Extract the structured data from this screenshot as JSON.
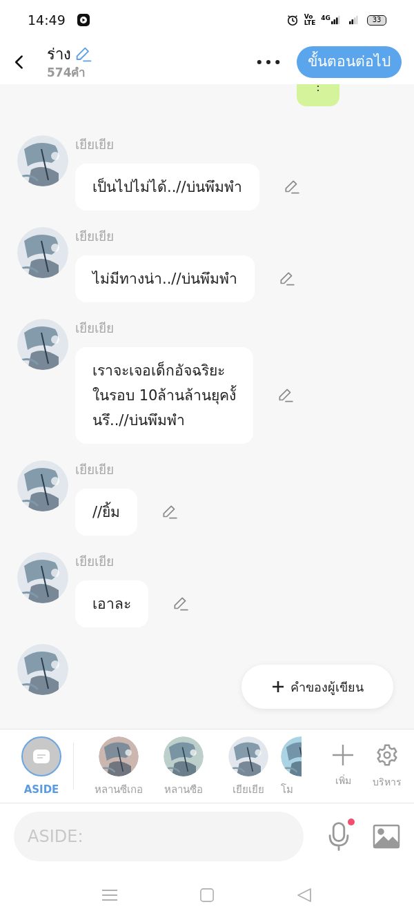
{
  "status_bar": {
    "time": "14:49",
    "volte_top": "Vo",
    "volte_bottom": "LTE",
    "network": "4G",
    "battery": "33"
  },
  "header": {
    "title": "ร่าง",
    "word_count": "574คำ",
    "next_button": "ขั้นตอนต่อไป"
  },
  "top_bubble": {
    "text": ":"
  },
  "messages": [
    {
      "name": "เยียเยีย",
      "lines": [
        "เป็นไปไม่ได้..//บ่นพึมพำ"
      ]
    },
    {
      "name": "เยียเยีย",
      "lines": [
        "ไม่มีทางน่า..//บ่นพึมพำ"
      ]
    },
    {
      "name": "เยียเยีย",
      "lines": [
        "เราจะเจอเด็กอัจฉริยะ",
        "ในรอบ 10ล้านล้านยุคงั้",
        "นรึ..//บ่นพึมพำ"
      ]
    },
    {
      "name": "เยียเยีย",
      "lines": [
        "//ยิ้ม"
      ]
    },
    {
      "name": "เยียเยีย",
      "lines": [
        "เอาละ"
      ]
    }
  ],
  "author_note_button": "คำของผู้เขียน",
  "characters": [
    {
      "kind": "aside",
      "name": "ASIDE",
      "selected": true
    },
    {
      "kind": "avatar",
      "name": "หลานซีเกอ",
      "selected": false
    },
    {
      "kind": "avatar",
      "name": "หลานซือ",
      "selected": false
    },
    {
      "kind": "avatar",
      "name": "เยียเยีย",
      "selected": false
    },
    {
      "kind": "avatar",
      "name": "โม",
      "selected": false
    }
  ],
  "add_label": "เพิ่ม",
  "manage_label": "บริหาร",
  "input": {
    "placeholder": "ASIDE:",
    "mic_notification": true
  }
}
